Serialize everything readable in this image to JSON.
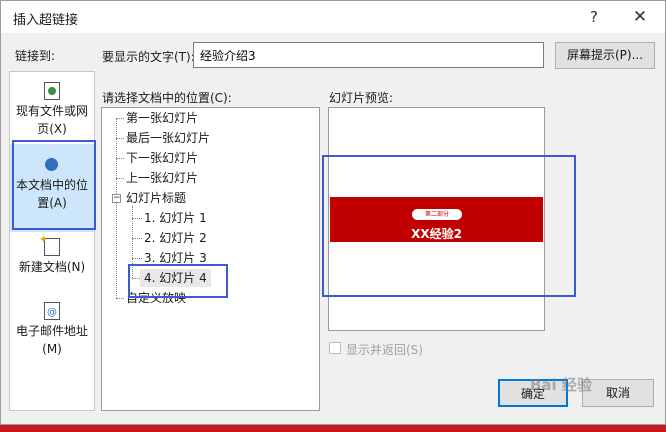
{
  "dialog": {
    "title": "插入超链接",
    "help_glyph": "?",
    "close_glyph": "✕"
  },
  "link_to": {
    "label_prefix": "链接到",
    "label_suffix": ":",
    "items": [
      {
        "label_line1": "现有文件或网",
        "label_line2": "页(X)",
        "icon": "existing-file-icon"
      },
      {
        "label_line1": "本文档中的位",
        "label_line2": "置(A)",
        "icon": "place-in-document-icon",
        "selected": true
      },
      {
        "label_line1": "新建文档(N)",
        "label_line2": "",
        "icon": "new-document-icon"
      },
      {
        "label_line1": "电子邮件地址",
        "label_line2": "(M)",
        "icon": "email-icon"
      }
    ]
  },
  "text_to_display": {
    "label": "要显示的文字(T):",
    "value": "经验介绍3"
  },
  "screentip_button": "屏幕提示(P)...",
  "place_label": "请选择文档中的位置(C):",
  "tree": {
    "nodes": [
      {
        "label": "第一张幻灯片"
      },
      {
        "label": "最后一张幻灯片"
      },
      {
        "label": "下一张幻灯片"
      },
      {
        "label": "上一张幻灯片"
      },
      {
        "label": "幻灯片标题",
        "expander": "−"
      },
      {
        "label": "1. 幻灯片 1"
      },
      {
        "label": "2. 幻灯片 2"
      },
      {
        "label": "3. 幻灯片 3"
      },
      {
        "label": "4. 幻灯片 4",
        "selected": true
      },
      {
        "label": "自定义放映"
      }
    ]
  },
  "preview": {
    "label": "幻灯片预览:",
    "slide_tag": "第二部分",
    "slide_title": "XX经验2"
  },
  "show_and_return": {
    "label": "显示并返回(S)",
    "checked": false,
    "enabled": false
  },
  "ok_button": "确定",
  "cancel_button": "取消",
  "watermark": "Bai 经验",
  "colors": {
    "accent": "#0078d7",
    "selection": "#cde6fb",
    "annotation": "#3c5bd0",
    "slide_red": "#c00000"
  }
}
